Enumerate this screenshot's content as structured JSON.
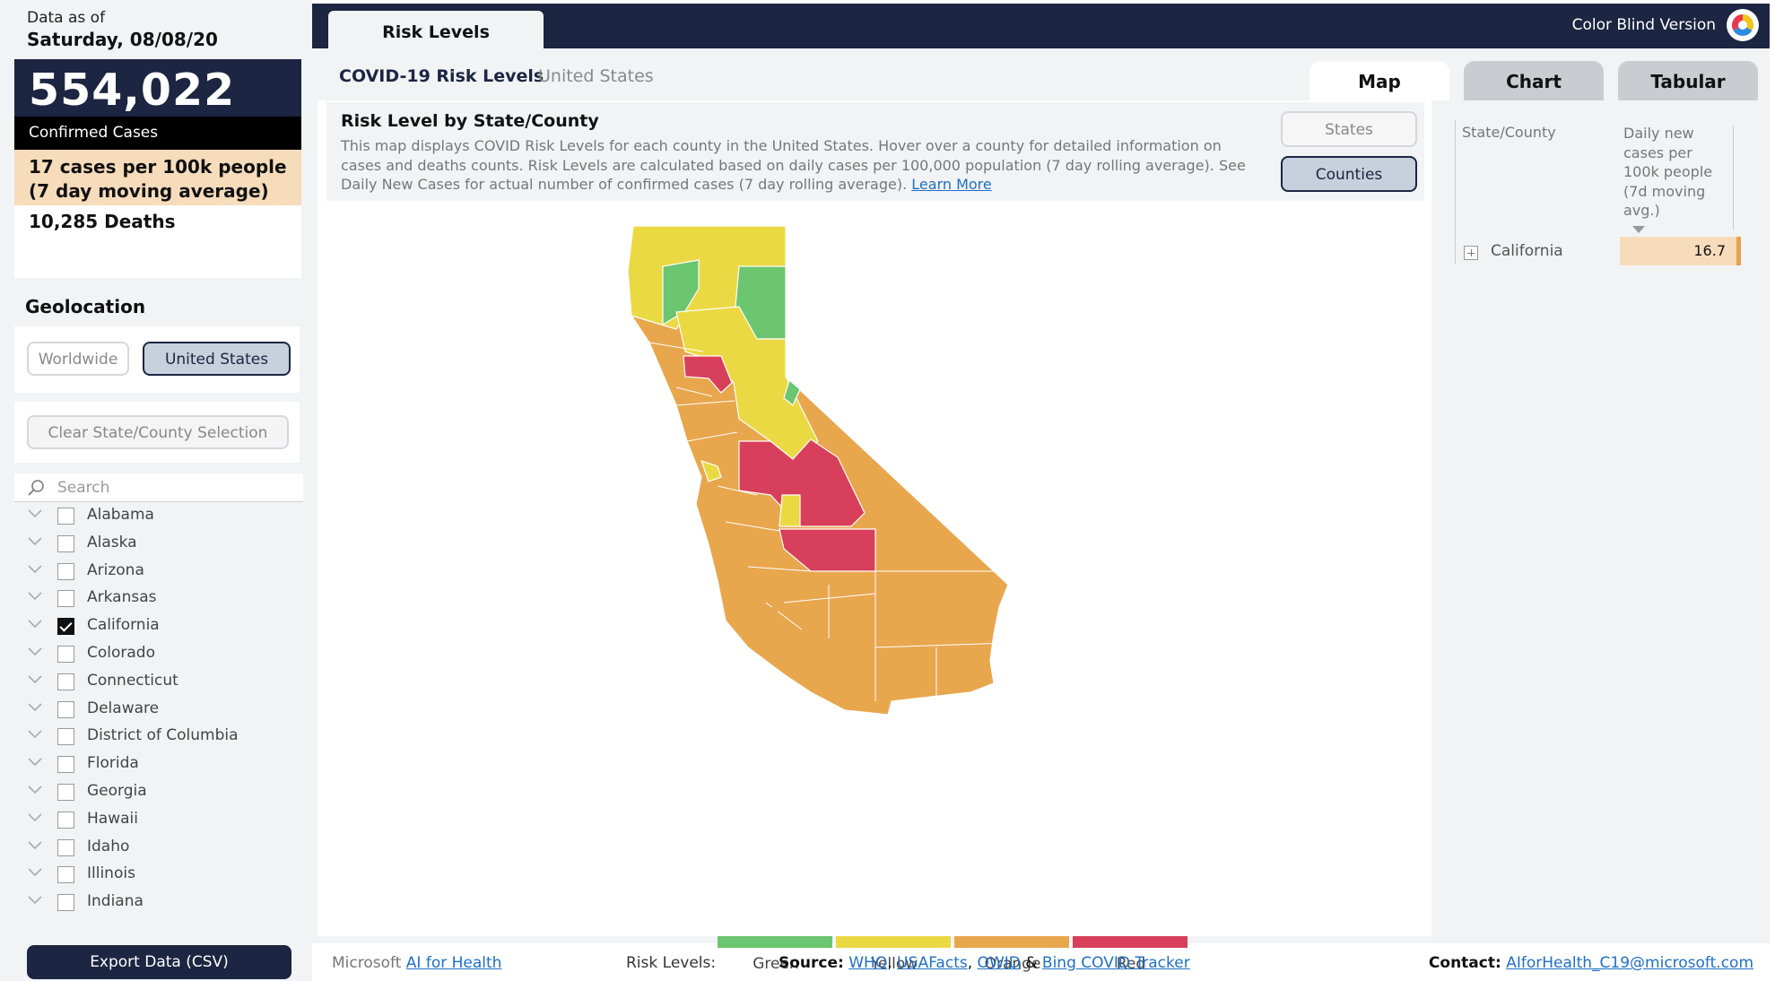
{
  "header": {
    "data_as_of_label": "Data as of",
    "data_as_of_date": "Saturday, 08/08/20",
    "tab_label": "Risk Levels",
    "color_blind_label": "Color Blind Version"
  },
  "kpi": {
    "confirmed_value": "554,022",
    "confirmed_label": "Confirmed Cases",
    "rate_line1": "17 cases per 100k people",
    "rate_line2": "(7 day moving average)",
    "deaths": "10,285 Deaths"
  },
  "geolocation": {
    "title": "Geolocation",
    "worldwide_label": "Worldwide",
    "us_label": "United States",
    "selected": "United States",
    "clear_label": "Clear State/County Selection"
  },
  "search": {
    "placeholder": "Search"
  },
  "states": [
    {
      "name": "Alabama",
      "checked": false
    },
    {
      "name": "Alaska",
      "checked": false
    },
    {
      "name": "Arizona",
      "checked": false
    },
    {
      "name": "Arkansas",
      "checked": false
    },
    {
      "name": "California",
      "checked": true
    },
    {
      "name": "Colorado",
      "checked": false
    },
    {
      "name": "Connecticut",
      "checked": false
    },
    {
      "name": "Delaware",
      "checked": false
    },
    {
      "name": "District of Columbia",
      "checked": false
    },
    {
      "name": "Florida",
      "checked": false
    },
    {
      "name": "Georgia",
      "checked": false
    },
    {
      "name": "Hawaii",
      "checked": false
    },
    {
      "name": "Idaho",
      "checked": false
    },
    {
      "name": "Illinois",
      "checked": false
    },
    {
      "name": "Indiana",
      "checked": false
    }
  ],
  "export_label": "Export Data (CSV)",
  "page": {
    "title": "COVID-19 Risk Levels",
    "subtitle": "United States",
    "view_tabs": [
      "Map",
      "Chart",
      "Tabular"
    ],
    "active_view": "Map"
  },
  "map_info": {
    "title": "Risk Level by State/County",
    "description": "This map displays COVID Risk Levels for each county in the United States. Hover over a county for detailed information on cases and deaths counts. Risk Levels are calculated based on daily cases per 100,000 population (7 day rolling average). See Daily New Cases for actual number of confirmed cases (7 day rolling average).",
    "learn_more": "Learn More",
    "states_button": "States",
    "counties_button": "Counties"
  },
  "legend": {
    "title": "Risk Levels:",
    "items": [
      {
        "label": "Green",
        "color": "#6cc56f"
      },
      {
        "label": "Yellow",
        "color": "#ebd944"
      },
      {
        "label": "Orange",
        "color": "#e8a64d"
      },
      {
        "label": "Red",
        "color": "#d83f5a"
      }
    ]
  },
  "table": {
    "col1": "State/County",
    "col2": "Daily new cases per 100k people (7d moving avg.)",
    "rows": [
      {
        "name": "California",
        "value": "16.7"
      }
    ]
  },
  "footer": {
    "left_prefix": "Microsoft",
    "left_link": "AI for Health",
    "source_label": "Source:",
    "source_links": [
      "WHO",
      "USAFacts",
      "OWID"
    ],
    "source_and": "&",
    "source_last": "Bing COVID Tracker",
    "contact_label": "Contact:",
    "contact_email": "AIforHealth_C19@microsoft.com"
  },
  "colors": {
    "navy": "#1c2541",
    "panel_bg": "#f2f3f5",
    "highlight": "#f6dcbb",
    "link": "#1e6fc5"
  }
}
